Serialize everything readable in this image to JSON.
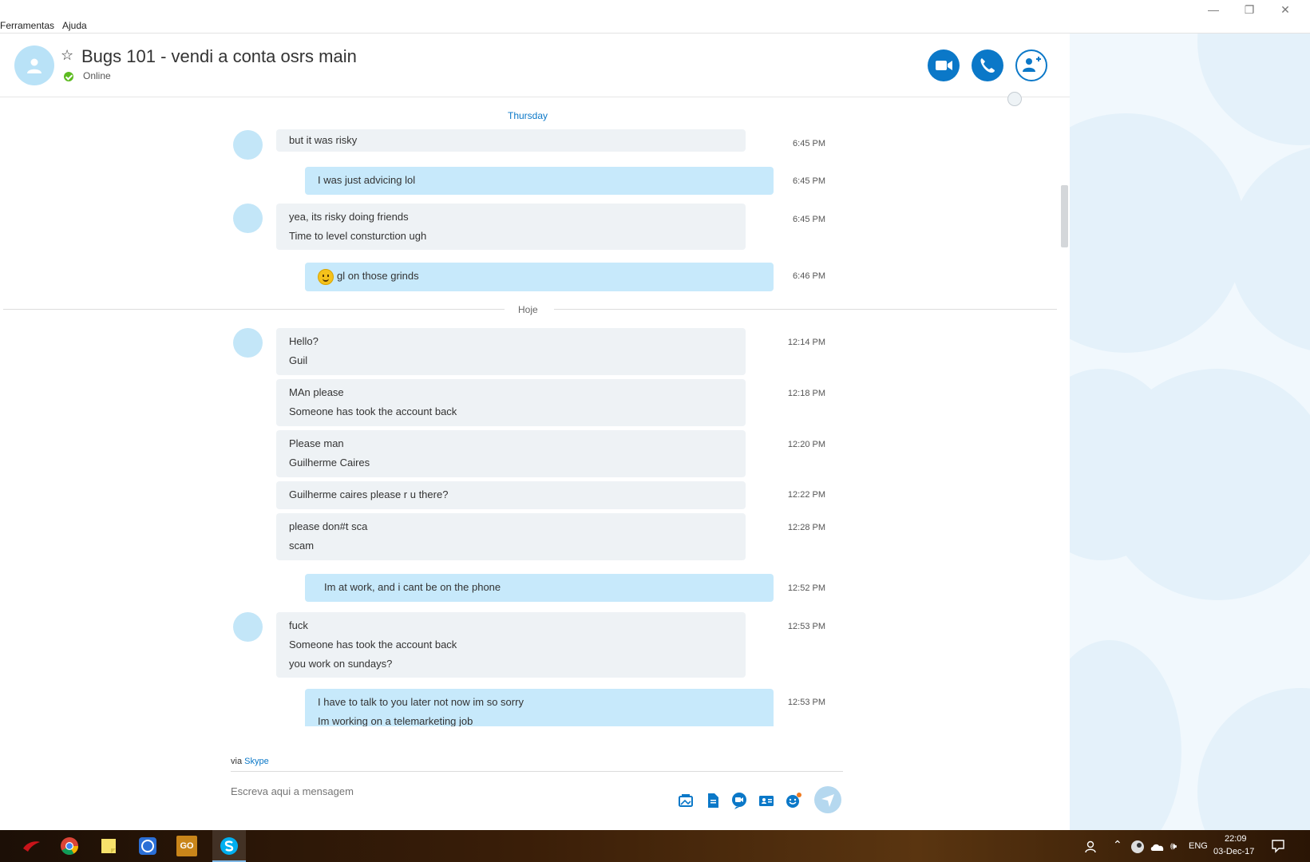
{
  "menu": {
    "items": [
      "Ferramentas",
      "Ajuda"
    ]
  },
  "window_controls": {
    "minimize": "—",
    "restore": "❐",
    "close": "✕"
  },
  "header": {
    "name": "Bugs 101 - vendi a conta osrs main",
    "status": "Online",
    "buttons": [
      "video-call",
      "audio-call",
      "add-people"
    ]
  },
  "chat": {
    "day_labels": {
      "thursday": "Thursday",
      "today": "Hoje"
    },
    "messages": [
      {
        "dir": "in",
        "lines": [
          "but it was risky"
        ],
        "time": "6:45 PM"
      },
      {
        "dir": "out",
        "lines": [
          "I was just advicing lol"
        ],
        "time": "6:45 PM"
      },
      {
        "dir": "in",
        "lines": [
          "yea, its risky doing friends",
          "Time to level consturction ugh"
        ],
        "time": "6:45 PM"
      },
      {
        "dir": "out",
        "lines": [
          "gl on those grinds"
        ],
        "time": "6:46 PM",
        "emoji": "smile"
      },
      {
        "dir": "in",
        "lines": [
          "Hello?",
          "Guil"
        ],
        "time": "12:14 PM"
      },
      {
        "dir": "in",
        "lines": [
          "MAn please",
          "Someone has took the account back"
        ],
        "time": "12:18 PM"
      },
      {
        "dir": "in",
        "lines": [
          "Please man",
          "Guilherme Caires"
        ],
        "time": "12:20 PM"
      },
      {
        "dir": "in",
        "lines": [
          "Guilherme caires please r u there?"
        ],
        "time": "12:22 PM"
      },
      {
        "dir": "in",
        "lines": [
          "please don#t sca",
          "scam"
        ],
        "time": "12:28 PM"
      },
      {
        "dir": "out",
        "lines": [
          "Im at work, and i cant be on the phone"
        ],
        "time": "12:52 PM"
      },
      {
        "dir": "in",
        "lines": [
          "fuck",
          "Someone has took the account back",
          "you work on sundays?"
        ],
        "time": "12:53 PM"
      },
      {
        "dir": "out",
        "lines": [
          "I have to talk to you later not now im so sorry",
          "Im working on a telemarketing job"
        ],
        "time": "12:53 PM"
      }
    ]
  },
  "composer": {
    "via_prefix": "via",
    "via_link": "Skype",
    "placeholder": "Escreva aqui a mensagem",
    "tools": [
      "media-icon",
      "file-icon",
      "video-message-icon",
      "contact-card-icon",
      "emoticon-icon"
    ]
  },
  "taskbar": {
    "apps": [
      "rog-icon",
      "chrome-icon",
      "sticky-notes-icon",
      "app-icon",
      "csgo-icon",
      "skype-icon"
    ],
    "csgo_label": "GO",
    "language": "ENG",
    "time": "22:09",
    "date": "03-Dec-17"
  },
  "colors": {
    "accent": "#0b78c8",
    "outgoing": "#c7e9fb",
    "incoming": "#eef2f5",
    "online": "#5dbb20"
  }
}
